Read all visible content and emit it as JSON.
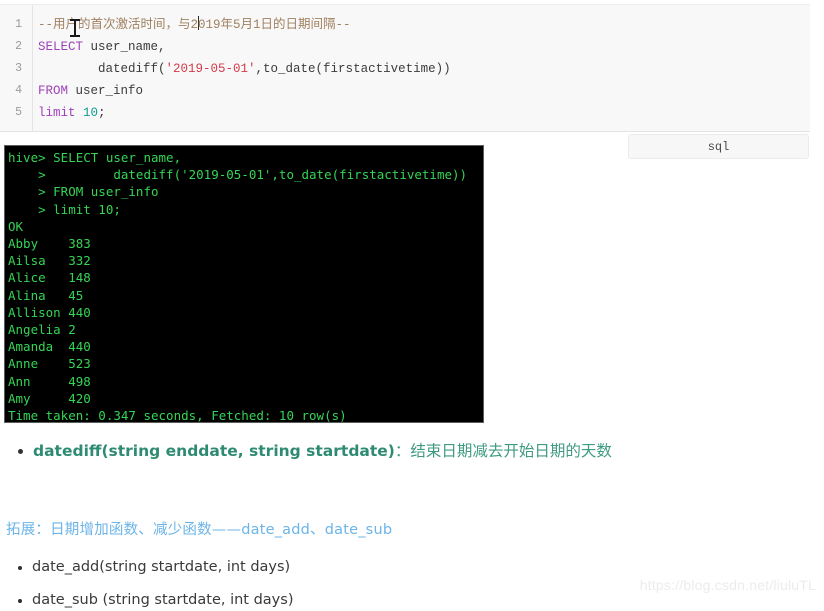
{
  "code_block": {
    "language_badge": "sql",
    "lines": [
      {
        "number": "1",
        "segments": [
          {
            "text": "--用户的首次激活时间，与2",
            "type": "comment"
          },
          {
            "text": "019年5月1日的日期间隔--",
            "type": "comment"
          }
        ],
        "plain": "--用户的首次激活时间，与2019年5月1日的日期间隔--"
      },
      {
        "number": "2",
        "keyword": "SELECT",
        "rest": " user_name,",
        "plain": "SELECT user_name,"
      },
      {
        "number": "3",
        "indent": "        ",
        "before_string": "datediff(",
        "string": "'2019-05-01'",
        "after_string": ",to_date(firstactivetime))",
        "plain": "        datediff('2019-05-01',to_date(firstactivetime))"
      },
      {
        "number": "4",
        "keyword": "FROM",
        "rest": " user_info",
        "plain": "FROM user_info"
      },
      {
        "number": "5",
        "keyword": "limit",
        "number_token": "10",
        "terminator": ";",
        "plain": "limit 10;"
      }
    ]
  },
  "terminal": {
    "lines": [
      "hive> SELECT user_name,",
      "    >         datediff('2019-05-01',to_date(firstactivetime))",
      "    > FROM user_info",
      "    > limit 10;",
      "OK",
      "Abby    383",
      "Ailsa   332",
      "Alice   148",
      "Alina   45",
      "Allison 440",
      "Angelia 2",
      "Amanda  440",
      "Anne    523",
      "Ann     498",
      "Amy     420",
      "Time taken: 0.347 seconds, Fetched: 10 row(s)"
    ],
    "results": {
      "columns": [
        "user_name",
        "datediff"
      ],
      "rows": [
        [
          "Abby",
          "383"
        ],
        [
          "Ailsa",
          "332"
        ],
        [
          "Alice",
          "148"
        ],
        [
          "Alina",
          "45"
        ],
        [
          "Allison",
          "440"
        ],
        [
          "Angelia",
          "2"
        ],
        [
          "Amanda",
          "440"
        ],
        [
          "Anne",
          "523"
        ],
        [
          "Ann",
          "498"
        ],
        [
          "Amy",
          "420"
        ]
      ],
      "status": "OK",
      "timing": "Time taken: 0.347 seconds, Fetched: 10 row(s)"
    }
  },
  "notes": {
    "datediff_signature": "datediff(string enddate, string startdate)",
    "datediff_separator": "：",
    "datediff_description": "结束日期减去开始日期的天数",
    "section_heading": "拓展：日期增加函数、减少函数——date_add、date_sub",
    "date_add_item": "date_add(string startdate, int days)",
    "date_sub_item": "date_sub (string startdate, int days)"
  },
  "watermark": "https://blog.csdn.net/liuluTL",
  "colors": {
    "keyword": "#9d42b8",
    "string": "#d33b4a",
    "number": "#0f9b8e",
    "comment": "#a08060",
    "terminal_text": "#35d455",
    "terminal_bg": "#000000",
    "note_green": "#2e8b72",
    "heading_blue": "#6cb4e8"
  }
}
